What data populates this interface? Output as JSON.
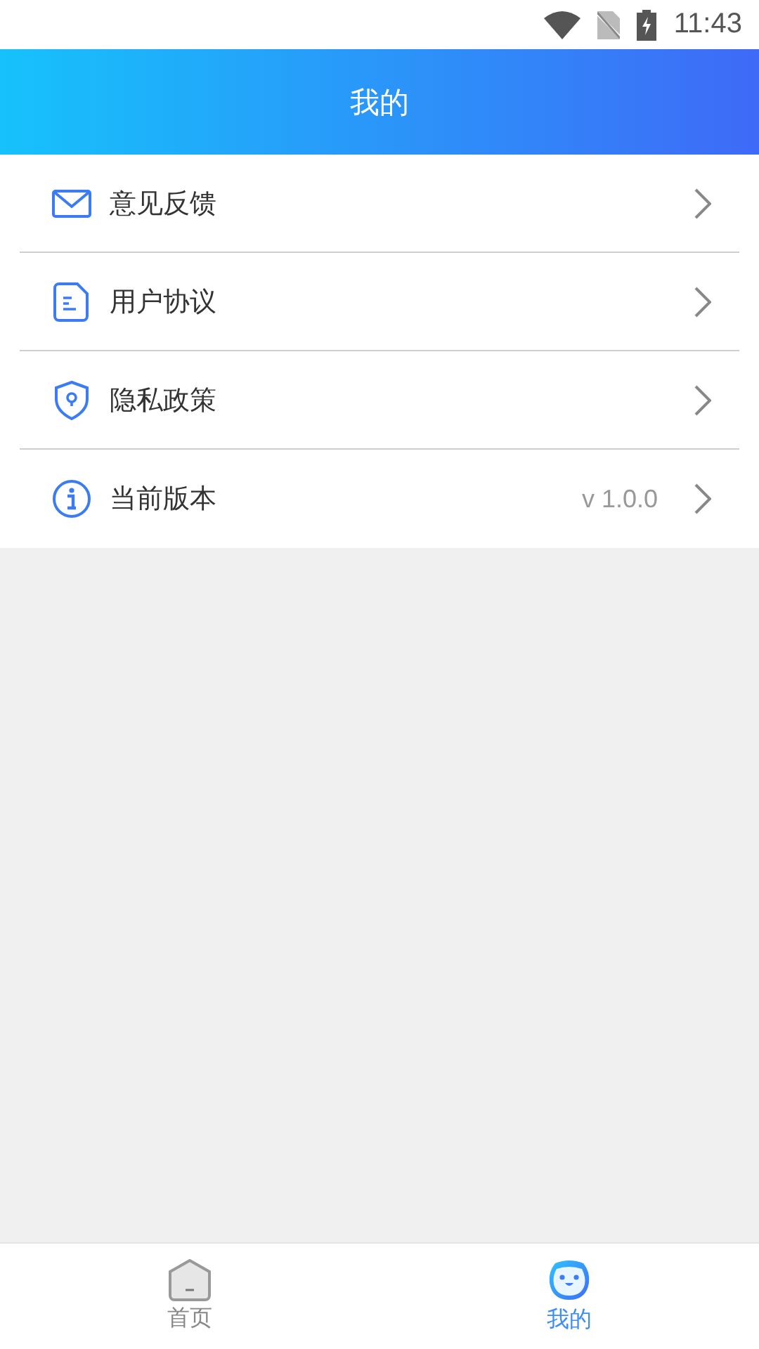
{
  "status_bar": {
    "time": "11:43"
  },
  "header": {
    "title": "我的"
  },
  "menu": [
    {
      "kind": "mail",
      "label": "意见反馈"
    },
    {
      "kind": "document",
      "label": "用户协议"
    },
    {
      "kind": "shield",
      "label": "隐私政策"
    },
    {
      "kind": "info",
      "label": "当前版本",
      "value": "v 1.0.0"
    }
  ],
  "tabs": [
    {
      "kind": "home",
      "label": "首页",
      "selected": false
    },
    {
      "kind": "mine",
      "label": "我的",
      "selected": true
    }
  ]
}
